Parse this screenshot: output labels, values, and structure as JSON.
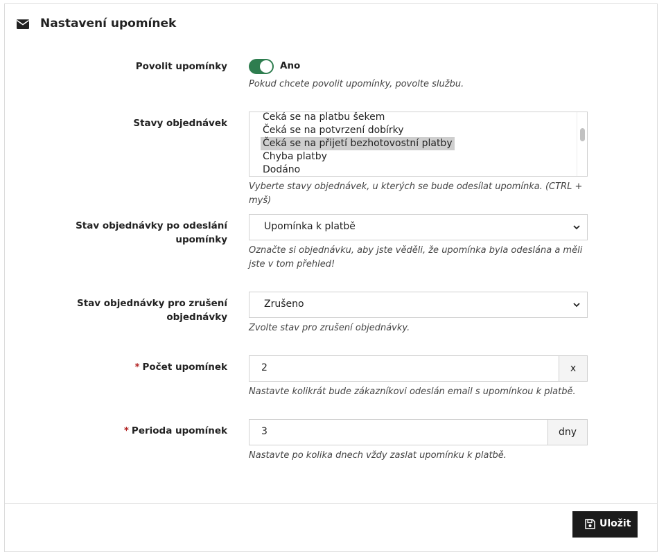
{
  "panel": {
    "title": "Nastavení upomínek",
    "header_icon": "envelope-icon"
  },
  "enable": {
    "label": "Povolit upomínky",
    "toggle_on": true,
    "toggle_label": "Ano",
    "help": "Pokud chcete povolit upomínky, povolte službu."
  },
  "order_states": {
    "label": "Stavy objednávek",
    "options": [
      {
        "label": "Čeká se na platbu šekem",
        "selected": false
      },
      {
        "label": "Čeká se na potvrzení dobírky",
        "selected": false
      },
      {
        "label": "Čeká se na přijetí bezhotovostní platby",
        "selected": true
      },
      {
        "label": "Chyba platby",
        "selected": false
      },
      {
        "label": "Dodáno",
        "selected": false
      }
    ],
    "help": "Vyberte stavy objednávek, u kterých se bude odesílat upomínka. (CTRL + myš)"
  },
  "state_after_send": {
    "label": "Stav objednávky po odeslání upomínky",
    "value": "Upomínka k platbě",
    "help": "Označte si objednávku, aby jste věděli, že upomínka byla odeslána a měli jste v tom přehled!"
  },
  "state_cancel": {
    "label": "Stav objednávky pro zrušení objednávky",
    "value": "Zrušeno",
    "help": "Zvolte stav pro zrušení objednávky."
  },
  "reminder_count": {
    "required_mark": "*",
    "label": "Počet upomínek",
    "value": "2",
    "addon": "x",
    "help": "Nastavte kolikrát bude zákazníkovi odeslán email s upomínkou k platbě."
  },
  "reminder_period": {
    "required_mark": "*",
    "label": "Perioda upomínek",
    "value": "3",
    "addon": "dny",
    "help": "Nastavte po kolika dnech vždy zaslat upomínku k platbě."
  },
  "footer": {
    "save_label": "Uložit",
    "save_icon": "floppy-disk-icon"
  },
  "colors": {
    "toggle_on": "#2e7d4f",
    "required": "#b22222",
    "button_bg": "#1b1b1b"
  }
}
